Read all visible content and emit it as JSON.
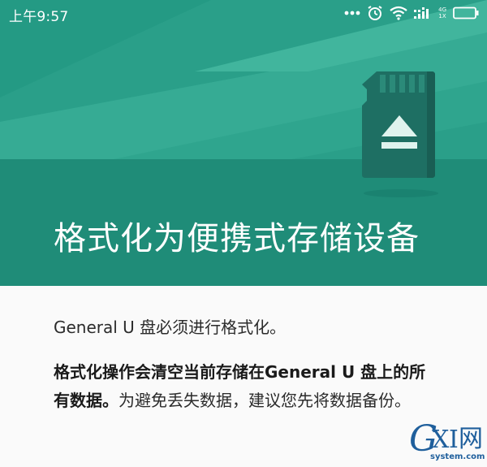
{
  "status_bar": {
    "time": "上午9:57",
    "network_top": "4G",
    "network_bottom": "1X"
  },
  "hero": {
    "title": "格式化为便携式存储设备",
    "background_color": "#22917d",
    "illustration": "sd-card-eject-icon"
  },
  "content": {
    "intro": "General U 盘必须进行格式化。",
    "warning_bold": "格式化操作会清空当前存储在General U 盘上的所有数据。",
    "warning_normal": "为避免丢失数据，建议您先将数据备份。"
  },
  "watermark": {
    "g": "G",
    "x": "X",
    "i": "I",
    "cn": "网",
    "domain": "system.com"
  },
  "colors": {
    "accent": "#22917d",
    "text": "#2b2b2b",
    "watermark": "#1f5f9c"
  }
}
